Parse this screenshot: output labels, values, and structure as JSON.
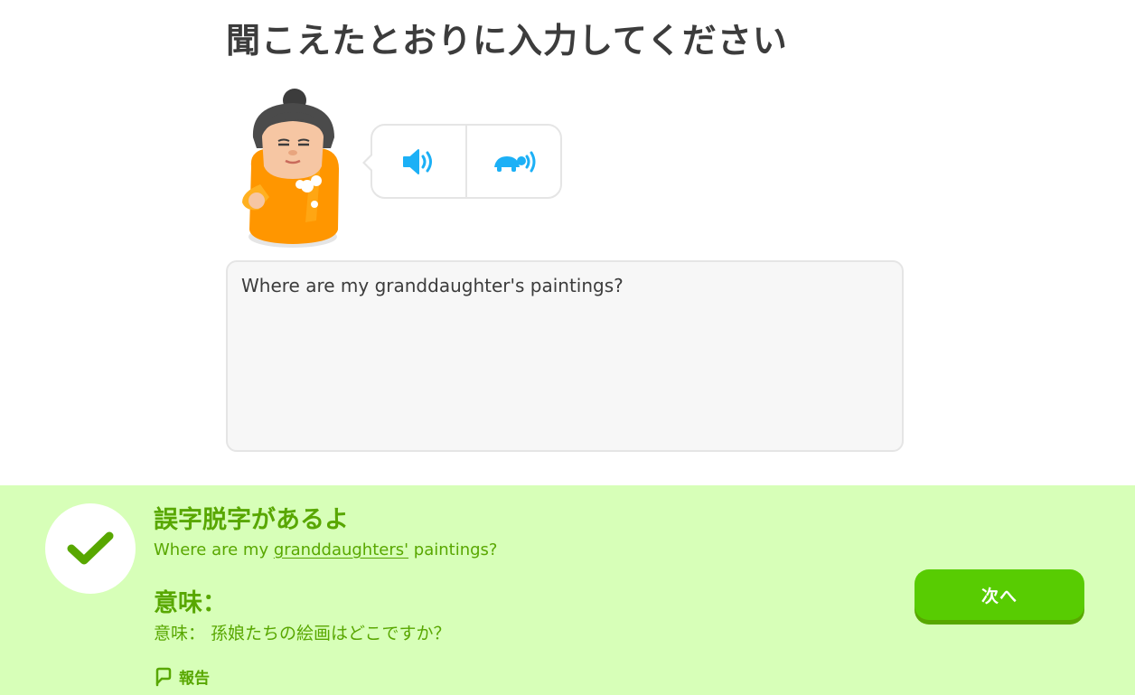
{
  "prompt": {
    "title": "聞こえたとおりに入力してください"
  },
  "audio": {
    "normal_icon": "speaker-icon",
    "slow_icon": "turtle-speaker-icon"
  },
  "answer": {
    "value": "Where are my granddaughter's paintings?"
  },
  "feedback": {
    "heading": "誤字脱字があるよ",
    "correct_prefix": "Where are my ",
    "correct_highlight": "granddaughters'",
    "correct_suffix": " paintings?",
    "meaning_label": "意味：",
    "meaning_text": "意味： 孫娘たちの絵画はどこですか？",
    "report_label": "報告",
    "next_label": "次へ"
  },
  "colors": {
    "accent_blue": "#1cb0f6",
    "feedback_bg": "#d7ffb8",
    "feedback_text": "#58a700",
    "button_green": "#58cc02",
    "character_orange": "#ff9600"
  }
}
